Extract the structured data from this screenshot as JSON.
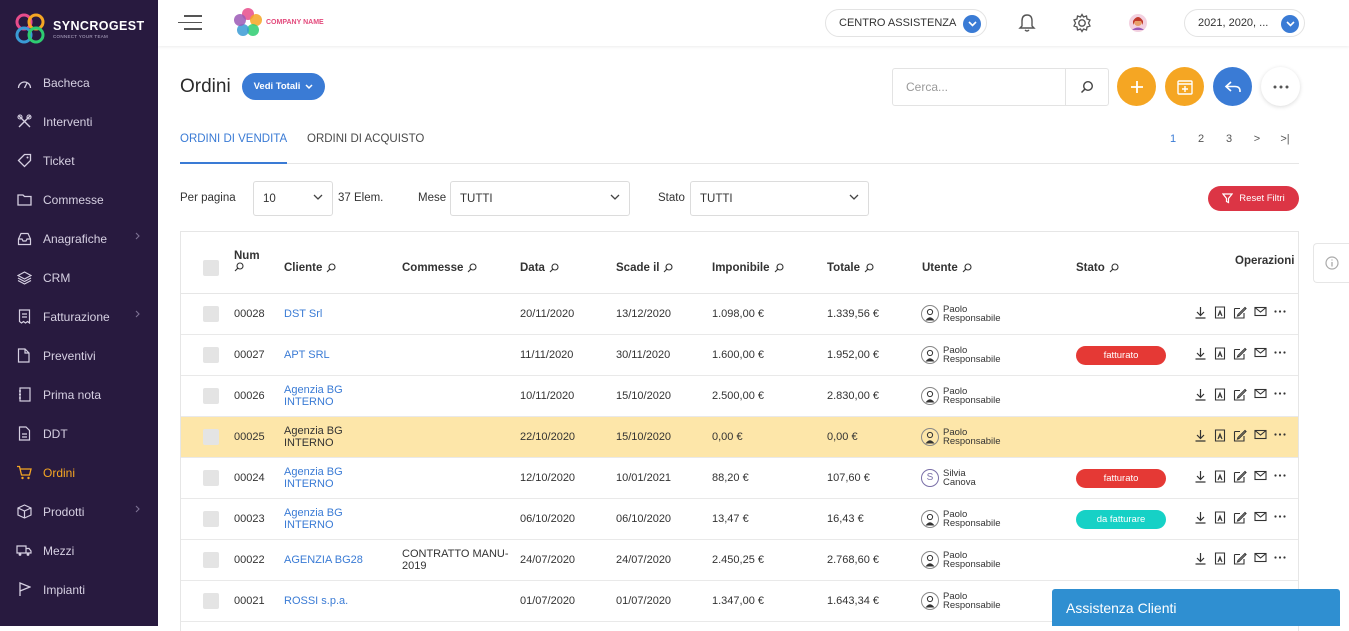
{
  "brand": {
    "name": "SYNCROGEST",
    "tagline": "CONNECT YOUR TEAM",
    "company_logo_text": "COMPANY NAME"
  },
  "sidebar": {
    "items": [
      {
        "label": "Bacheca",
        "icon": "dashboard-icon",
        "has_submenu": false
      },
      {
        "label": "Interventi",
        "icon": "tools-icon",
        "has_submenu": false
      },
      {
        "label": "Ticket",
        "icon": "tag-icon",
        "has_submenu": false
      },
      {
        "label": "Commesse",
        "icon": "folder-icon",
        "has_submenu": false
      },
      {
        "label": "Anagrafiche",
        "icon": "inbox-icon",
        "has_submenu": true
      },
      {
        "label": "CRM",
        "icon": "layers-icon",
        "has_submenu": false
      },
      {
        "label": "Fatturazione",
        "icon": "invoice-icon",
        "has_submenu": true
      },
      {
        "label": "Preventivi",
        "icon": "quote-icon",
        "has_submenu": false
      },
      {
        "label": "Prima nota",
        "icon": "notebook-icon",
        "has_submenu": false
      },
      {
        "label": "DDT",
        "icon": "document-icon",
        "has_submenu": false
      },
      {
        "label": "Ordini",
        "icon": "cart-icon",
        "has_submenu": false,
        "active": true
      },
      {
        "label": "Prodotti",
        "icon": "box-icon",
        "has_submenu": true
      },
      {
        "label": "Mezzi",
        "icon": "truck-icon",
        "has_submenu": false
      },
      {
        "label": "Impianti",
        "icon": "flag-icon",
        "has_submenu": false
      }
    ]
  },
  "topbar": {
    "assistance_label": "CENTRO ASSISTENZA",
    "years_label": "2021, 2020, ..."
  },
  "page": {
    "title": "Ordini",
    "totals_button": "Vedi Totali",
    "search_placeholder": "Cerca...",
    "tabs": [
      {
        "label": "ORDINI DI VENDITA",
        "active": true
      },
      {
        "label": "ORDINI DI ACQUISTO",
        "active": false
      }
    ],
    "pager": [
      "1",
      "2",
      "3",
      ">",
      ">|"
    ],
    "current_page": "1"
  },
  "filters": {
    "per_page_label": "Per pagina",
    "per_page_value": "10",
    "count_label": "37 Elem.",
    "month_label": "Mese",
    "month_value": "TUTTI",
    "status_label": "Stato",
    "status_value": "TUTTI",
    "reset_label": "Reset Filtri"
  },
  "table": {
    "headers": {
      "num": "Num",
      "cliente": "Cliente",
      "commesse": "Commesse",
      "data": "Data",
      "scade": "Scade il",
      "imponibile": "Imponibile",
      "totale": "Totale",
      "utente": "Utente",
      "stato": "Stato",
      "operazioni": "Operazioni"
    },
    "rows": [
      {
        "num": "00028",
        "cliente": "DST Srl",
        "cliente2": "",
        "commessa": "",
        "commessa2": "",
        "data": "20/11/2020",
        "scade": "13/12/2020",
        "imponibile": "1.098,00 €",
        "totale": "1.339,56 €",
        "utente1": "Paolo",
        "utente2": "Responsabile",
        "avatar": "person",
        "stato": "",
        "stato_color": "",
        "link": true,
        "highlight": false
      },
      {
        "num": "00027",
        "cliente": "APT SRL",
        "cliente2": "",
        "commessa": "",
        "commessa2": "",
        "data": "11/11/2020",
        "scade": "30/11/2020",
        "imponibile": "1.600,00 €",
        "totale": "1.952,00 €",
        "utente1": "Paolo",
        "utente2": "Responsabile",
        "avatar": "person",
        "stato": "fatturato",
        "stato_color": "red",
        "link": true,
        "highlight": false
      },
      {
        "num": "00026",
        "cliente": "Agenzia BG",
        "cliente2": "INTERNO",
        "commessa": "",
        "commessa2": "",
        "data": "10/11/2020",
        "scade": "15/10/2020",
        "imponibile": "2.500,00 €",
        "totale": "2.830,00 €",
        "utente1": "Paolo",
        "utente2": "Responsabile",
        "avatar": "person",
        "stato": "",
        "stato_color": "",
        "link": true,
        "highlight": false
      },
      {
        "num": "00025",
        "cliente": "Agenzia BG",
        "cliente2": "INTERNO",
        "commessa": "",
        "commessa2": "",
        "data": "22/10/2020",
        "scade": "15/10/2020",
        "imponibile": "0,00 €",
        "totale": "0,00 €",
        "utente1": "Paolo",
        "utente2": "Responsabile",
        "avatar": "person",
        "stato": "",
        "stato_color": "",
        "link": false,
        "highlight": true
      },
      {
        "num": "00024",
        "cliente": "Agenzia BG",
        "cliente2": "INTERNO",
        "commessa": "",
        "commessa2": "",
        "data": "12/10/2020",
        "scade": "10/01/2021",
        "imponibile": "88,20 €",
        "totale": "107,60 €",
        "utente1": "Silvia",
        "utente2": "Canova",
        "avatar": "S",
        "stato": "fatturato",
        "stato_color": "red",
        "link": true,
        "highlight": false
      },
      {
        "num": "00023",
        "cliente": "Agenzia BG",
        "cliente2": "INTERNO",
        "commessa": "",
        "commessa2": "",
        "data": "06/10/2020",
        "scade": "06/10/2020",
        "imponibile": "13,47 €",
        "totale": "16,43 €",
        "utente1": "Paolo",
        "utente2": "Responsabile",
        "avatar": "person",
        "stato": "da fatturare",
        "stato_color": "teal",
        "link": true,
        "highlight": false
      },
      {
        "num": "00022",
        "cliente": "AGENZIA BG28",
        "cliente2": "",
        "commessa": "CONTRATTO MANU-",
        "commessa2": "2019",
        "data": "24/07/2020",
        "scade": "24/07/2020",
        "imponibile": "2.450,25 €",
        "totale": "2.768,60 €",
        "utente1": "Paolo",
        "utente2": "Responsabile",
        "avatar": "person",
        "stato": "",
        "stato_color": "",
        "link": true,
        "highlight": false
      },
      {
        "num": "00021",
        "cliente": "ROSSI s.p.a.",
        "cliente2": "",
        "commessa": "",
        "commessa2": "",
        "data": "01/07/2020",
        "scade": "01/07/2020",
        "imponibile": "1.347,00 €",
        "totale": "1.643,34 €",
        "utente1": "Paolo",
        "utente2": "Responsabile",
        "avatar": "person",
        "stato": "",
        "stato_color": "",
        "link": true,
        "highlight": false
      }
    ]
  },
  "chat": {
    "label": "Assistenza Clienti"
  },
  "colors": {
    "sidebar_bg": "#281a3f",
    "accent_orange": "#f5a623",
    "primary_blue": "#3a7bd5",
    "danger_red": "#e53935",
    "teal": "#16d1c6",
    "highlight_row": "#fde6a9"
  }
}
